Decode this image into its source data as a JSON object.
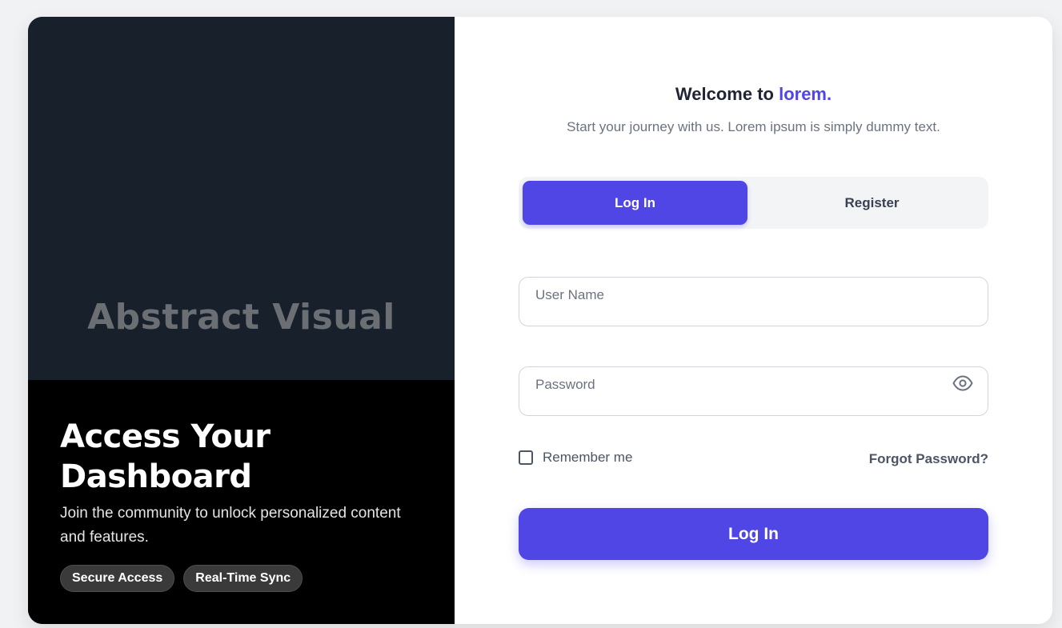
{
  "colors": {
    "accent": "#4f46e5",
    "left_visual_bg": "#18202b",
    "left_promo_bg": "#000000"
  },
  "visual": {
    "label": "Abstract Visual"
  },
  "promo": {
    "title": "Access Your Dashboard",
    "subtitle": "Join the community to unlock personalized content and features.",
    "chips": [
      "Secure Access",
      "Real-Time Sync"
    ]
  },
  "header": {
    "welcome_prefix": "Welcome to",
    "brand": "lorem.",
    "tagline": "Start your journey with us. Lorem ipsum is simply dummy text."
  },
  "tabs": {
    "login_label": "Log In",
    "register_label": "Register",
    "active": "login"
  },
  "form": {
    "username_placeholder": "User Name",
    "password_placeholder": "Password",
    "password_toggle_icon": "eye-icon",
    "remember_label": "Remember me",
    "remember_checked": false,
    "forgot_label": "Forgot Password?",
    "submit_label": "Log In"
  }
}
